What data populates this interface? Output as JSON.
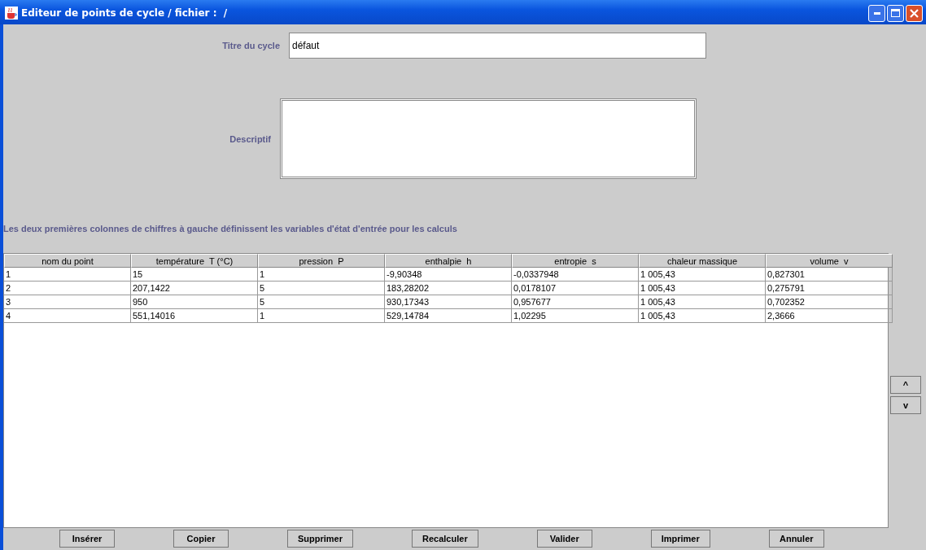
{
  "window": {
    "title": "Editeur de points de cycle / fichier :  /"
  },
  "form": {
    "title_label": "Titre du cycle",
    "title_value": "défaut",
    "description_label": "Descriptif"
  },
  "note": "Les deux premières colonnes de chiffres à gauche définissent les variables d'état d'entrée pour les calculs",
  "table": {
    "columns": [
      "nom du point",
      "température  T (°C)",
      "pression  P",
      "enthalpie  h",
      "entropie  s",
      "chaleur massique",
      "volume  v"
    ],
    "rows": [
      [
        "1",
        "15",
        "1",
        "-9,90348",
        "-0,0337948",
        "1 005,43",
        "0,827301"
      ],
      [
        "2",
        "207,1422",
        "5",
        "183,28202",
        "0,0178107",
        "1 005,43",
        "0,275791"
      ],
      [
        "3",
        "950",
        "5",
        "930,17343",
        "0,957677",
        "1 005,43",
        "0,702352"
      ],
      [
        "4",
        "551,14016",
        "1",
        "529,14784",
        "1,02295",
        "1 005,43",
        "2,3666"
      ]
    ]
  },
  "side_buttons": [
    "^",
    "v"
  ],
  "buttons": [
    "Insérer",
    "Copier",
    "Supprimer",
    "Recalculer",
    "Valider",
    "Imprimer",
    "Annuler"
  ]
}
